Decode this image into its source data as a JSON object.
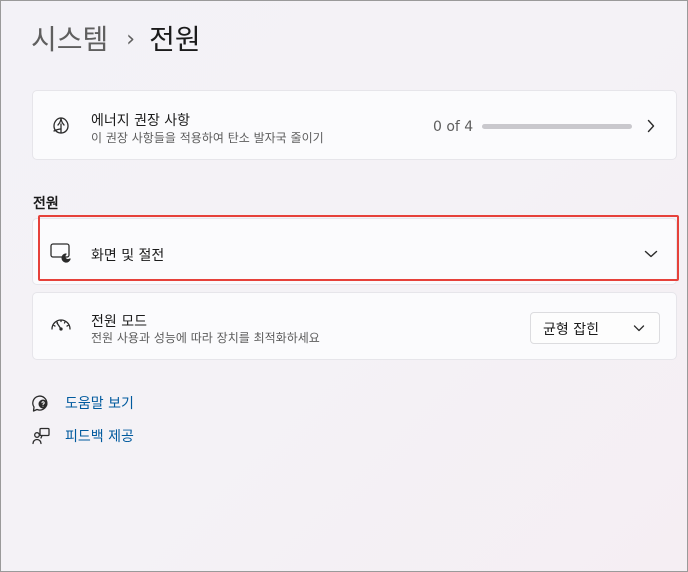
{
  "breadcrumb": {
    "parent": "시스템",
    "separator": "›",
    "current": "전원"
  },
  "recommendations": {
    "title": "에너지 권장 사항",
    "description": "이 권장 사항들을 적용하여 탄소 발자국 줄이기",
    "progress_text": "0 of 4",
    "progress_fraction": 0.0,
    "icon": "leaf-icon"
  },
  "section": {
    "label": "전원"
  },
  "screen_sleep": {
    "title": "화면 및 절전",
    "icon": "screen-sleep-icon"
  },
  "power_mode": {
    "title": "전원 모드",
    "description": "전원 사용과 성능에 따라 장치를 최적화하세요",
    "selected": "균형 잡힌",
    "icon": "gauge-icon"
  },
  "links": {
    "help": "도움말 보기",
    "feedback": "피드백 제공"
  },
  "colors": {
    "accent": "#0067c0",
    "highlight": "#e6413a",
    "link": "#005a9e"
  }
}
